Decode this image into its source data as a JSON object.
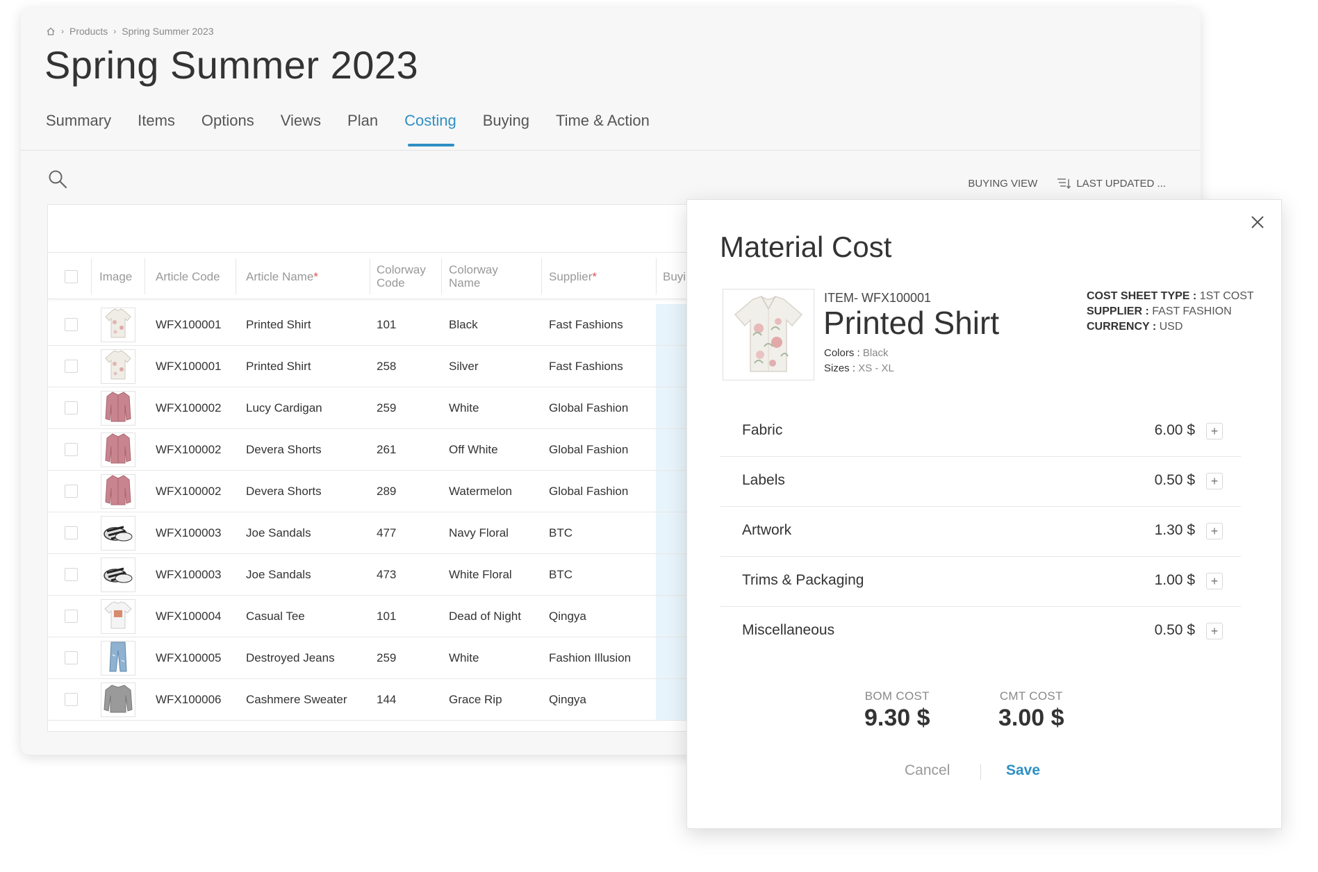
{
  "breadcrumb": {
    "home_icon": "home-icon",
    "items": [
      "Products",
      "Spring Summer 2023"
    ]
  },
  "page": {
    "title": "Spring Summer 2023"
  },
  "tabs": [
    {
      "label": "Summary"
    },
    {
      "label": "Items"
    },
    {
      "label": "Options"
    },
    {
      "label": "Views"
    },
    {
      "label": "Plan"
    },
    {
      "label": "Costing",
      "active": true
    },
    {
      "label": "Buying"
    },
    {
      "label": "Time & Action"
    }
  ],
  "toolbar": {
    "buying_view": "BUYING VIEW",
    "last_updated": "LAST UPDATED ..."
  },
  "table": {
    "headers": {
      "image": "Image",
      "article_code": "Article Code",
      "article_name": "Article Name",
      "required": "*",
      "colorway_code_1": "Colorway",
      "colorway_code_2": "Code",
      "colorway_name_1": "Colorway",
      "colorway_name_2": "Name",
      "supplier": "Supplier",
      "buying": "Buyi"
    },
    "rows": [
      {
        "code": "WFX100001",
        "name": "Printed Shirt",
        "cw_code": "101",
        "cw_name": "Black",
        "supplier": "Fast Fashions",
        "thumb": "shirt"
      },
      {
        "code": "WFX100001",
        "name": "Printed Shirt",
        "cw_code": "258",
        "cw_name": "Silver",
        "supplier": "Fast Fashions",
        "thumb": "shirt"
      },
      {
        "code": "WFX100002",
        "name": "Lucy Cardigan",
        "cw_code": "259",
        "cw_name": "White",
        "supplier": "Global Fashion",
        "thumb": "cardigan"
      },
      {
        "code": "WFX100002",
        "name": "Devera Shorts",
        "cw_code": "261",
        "cw_name": "Off White",
        "supplier": "Global Fashion",
        "thumb": "cardigan"
      },
      {
        "code": "WFX100002",
        "name": "Devera Shorts",
        "cw_code": "289",
        "cw_name": "Watermelon",
        "supplier": "Global Fashion",
        "thumb": "cardigan"
      },
      {
        "code": "WFX100003",
        "name": "Joe Sandals",
        "cw_code": "477",
        "cw_name": "Navy Floral",
        "supplier": "BTC",
        "thumb": "sandals"
      },
      {
        "code": "WFX100003",
        "name": "Joe Sandals",
        "cw_code": "473",
        "cw_name": "White Floral",
        "supplier": "BTC",
        "thumb": "sandals"
      },
      {
        "code": "WFX100004",
        "name": "Casual Tee",
        "cw_code": "101",
        "cw_name": "Dead of Night",
        "supplier": "Qingya",
        "thumb": "tee"
      },
      {
        "code": "WFX100005",
        "name": "Destroyed Jeans",
        "cw_code": "259",
        "cw_name": "White",
        "supplier": "Fashion Illusion",
        "thumb": "jeans"
      },
      {
        "code": "WFX100006",
        "name": "Cashmere Sweater",
        "cw_code": "144",
        "cw_name": "Grace Rip",
        "supplier": "Qingya",
        "thumb": "sweater"
      }
    ]
  },
  "modal": {
    "title": "Material Cost",
    "item_code": "ITEM- WFX100001",
    "product_name": "Printed Shirt",
    "colors_label": "Colors :",
    "colors_value": "Black",
    "sizes_label": "Sizes :",
    "sizes_value": "XS - XL",
    "meta": {
      "cost_sheet_label": "COST SHEET TYPE :",
      "cost_sheet_value": "1ST COST",
      "supplier_label": "SUPPLIER :",
      "supplier_value": "FAST FASHION",
      "currency_label": "CURRENCY :",
      "currency_value": "USD"
    },
    "costs": [
      {
        "label": "Fabric",
        "value": "6.00 $"
      },
      {
        "label": "Labels",
        "value": "0.50 $"
      },
      {
        "label": "Artwork",
        "value": "1.30 $"
      },
      {
        "label": "Trims & Packaging",
        "value": "1.00 $"
      },
      {
        "label": "Miscellaneous",
        "value": "0.50 $"
      }
    ],
    "bom_label": "BOM COST",
    "bom_value": "9.30 $",
    "cmt_label": "CMT COST",
    "cmt_value": "3.00 $",
    "cancel_label": "Cancel",
    "save_label": "Save"
  },
  "colors": {
    "accent": "#2e8fc4",
    "required": "#d9534f",
    "highlight_column": "#e8f4fb"
  }
}
